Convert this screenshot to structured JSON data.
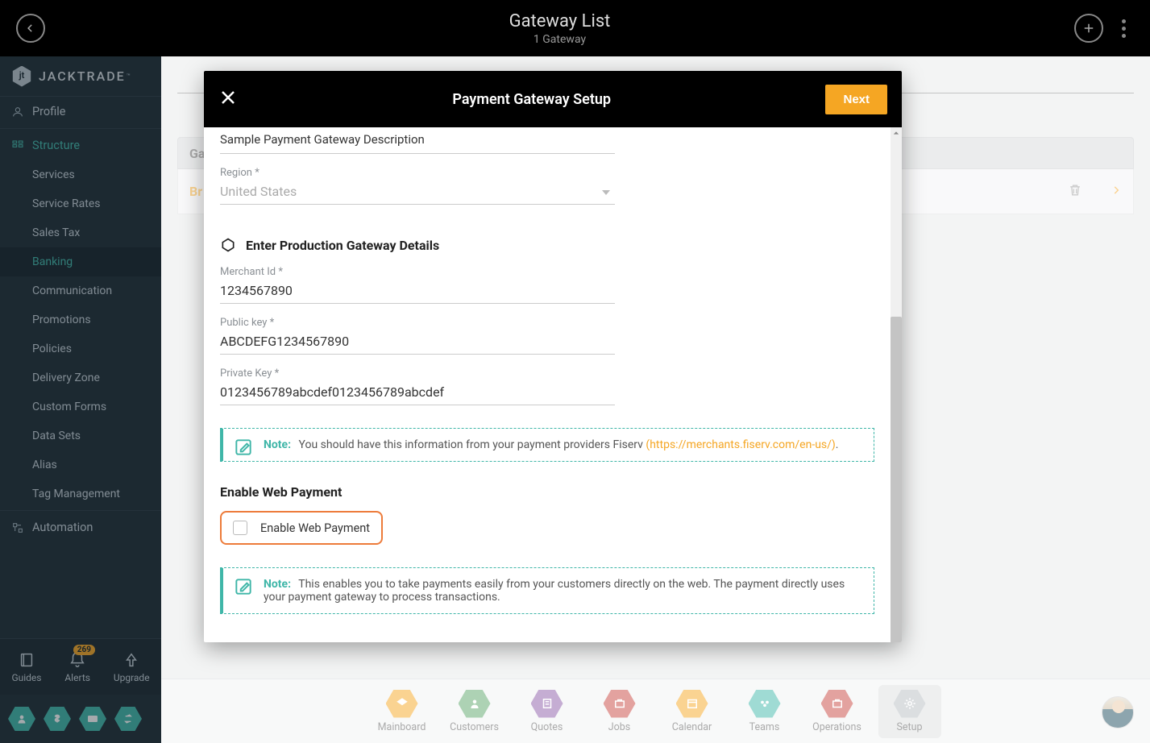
{
  "topbar": {
    "title": "Gateway List",
    "subtitle": "1 Gateway"
  },
  "brand": {
    "name": "JACKTRADE",
    "tm": "™"
  },
  "sidebar": {
    "profile": "Profile",
    "structure": "Structure",
    "structure_children": [
      "Services",
      "Service Rates",
      "Sales Tax",
      "Banking",
      "Communication",
      "Promotions",
      "Policies",
      "Delivery Zone",
      "Custom Forms",
      "Data Sets",
      "Alias",
      "Tag Management"
    ],
    "automation": "Automation"
  },
  "sidebar_footer": {
    "guides": "Guides",
    "alerts": "Alerts",
    "alerts_count": "269",
    "upgrade": "Upgrade"
  },
  "bg": {
    "col_header": "Ga",
    "row_partial": "Br"
  },
  "bottomnav": {
    "items": [
      {
        "label": "Mainboard",
        "color": "#f5a623"
      },
      {
        "label": "Customers",
        "color": "#5aa469"
      },
      {
        "label": "Quotes",
        "color": "#8a5aa6"
      },
      {
        "label": "Jobs",
        "color": "#c6443f"
      },
      {
        "label": "Calendar",
        "color": "#f5a623"
      },
      {
        "label": "Teams",
        "color": "#3fb6a8"
      },
      {
        "label": "Operations",
        "color": "#c6443f"
      },
      {
        "label": "Setup",
        "color": "#b6bcc1"
      }
    ]
  },
  "modal": {
    "title": "Payment Gateway Setup",
    "next": "Next",
    "desc_partial": "Sample Payment Gateway Description",
    "region_label": "Region",
    "region_value": "United States",
    "section_header": "Enter Production Gateway Details",
    "merchant_id_label": "Merchant Id",
    "merchant_id_value": "1234567890",
    "public_key_label": "Public key",
    "public_key_value": "ABCDEFG1234567890",
    "private_key_label": "Private Key",
    "private_key_value": "0123456789abcdef0123456789abcdef",
    "note_label": "Note:",
    "note1_text": "You should have this information from your payment providers Fiserv ",
    "note1_link": "(https://merchants.fiserv.com/en-us/)",
    "note1_link_after": ".",
    "enable_web_title": "Enable Web Payment",
    "enable_web_checkbox": "Enable Web Payment",
    "note2_text": "This enables you to take payments easily from your customers directly on the web. The payment directly uses your payment gateway to process transactions."
  }
}
